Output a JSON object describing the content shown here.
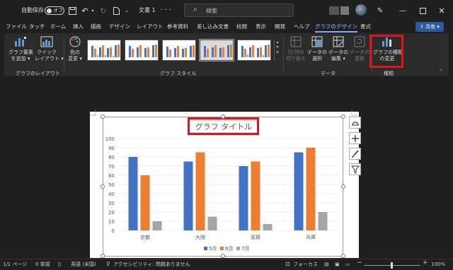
{
  "titlebar": {
    "autosave_label": "自動保存",
    "autosave_state": "オフ",
    "document_name": "文書 1",
    "document_suffix": "・・・",
    "search_placeholder": "検索"
  },
  "menu": {
    "items": [
      "ファイル",
      "タッチ",
      "ホーム",
      "挿入",
      "描画",
      "デザイン",
      "レイアウト",
      "参考資料",
      "差し込み文書",
      "校閲",
      "表示",
      "開発",
      "ヘルプ",
      "グラフのデザイン",
      "書式"
    ],
    "active": "グラフのデザイン",
    "share_label": "共有"
  },
  "ribbon": {
    "add_element_label1": "グラフ要素",
    "add_element_label2": "を追加",
    "quick_layout_label1": "クイック",
    "quick_layout_label2": "レイアウト",
    "layout_group": "グラフのレイアウト",
    "color_label1": "色の",
    "color_label2": "変更",
    "style_group": "グラフ スタイル",
    "switch_label1": "行/列の",
    "switch_label2": "切り替え",
    "select_data_label1": "データの",
    "select_data_label2": "選択",
    "edit_data_label1": "データの",
    "edit_data_label2": "編集",
    "refresh_label1": "データの",
    "refresh_label2": "更新",
    "data_group": "データ",
    "change_type_label1": "グラフの種類",
    "change_type_label2": "の変更",
    "type_group": "種類"
  },
  "chart_data": {
    "type": "bar",
    "title": "グラフ タイトル",
    "categories": [
      "京都",
      "大阪",
      "滋賀",
      "兵庫"
    ],
    "series": [
      {
        "name": "5月",
        "values": [
          80,
          75,
          70,
          85
        ],
        "color": "#4472c4"
      },
      {
        "name": "6月",
        "values": [
          60,
          85,
          75,
          90
        ],
        "color": "#ed7d31"
      },
      {
        "name": "7月",
        "values": [
          10,
          15,
          7,
          20
        ],
        "color": "#a5a5a5"
      }
    ],
    "ylim": [
      0,
      100
    ],
    "yticks": [
      0,
      10,
      20,
      30,
      40,
      50,
      60,
      70,
      80,
      90,
      100
    ],
    "legend_position": "bottom",
    "grid": true
  },
  "statusbar": {
    "page": "1/1 ページ",
    "words": "0 単語",
    "language": "英語 (米国)",
    "accessibility": "アクセシビリティ: 問題ありません",
    "focus": "フォーカス",
    "zoom": "100%"
  }
}
